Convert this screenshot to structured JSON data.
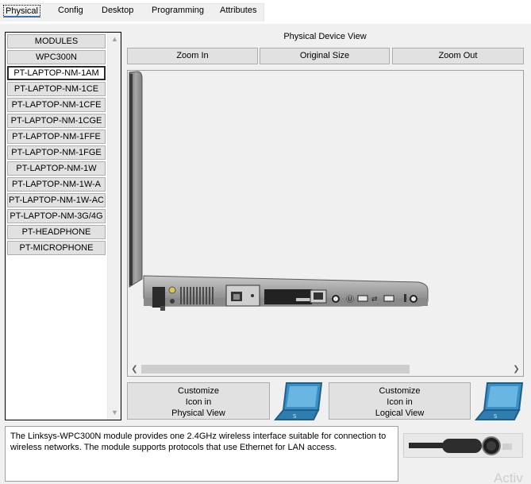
{
  "tabs": [
    {
      "label": "Physical",
      "active": true
    },
    {
      "label": "Config",
      "active": false
    },
    {
      "label": "Desktop",
      "active": false
    },
    {
      "label": "Programming",
      "active": false
    },
    {
      "label": "Attributes",
      "active": false
    }
  ],
  "modules": {
    "items": [
      {
        "label": "MODULES"
      },
      {
        "label": "WPC300N"
      },
      {
        "label": "PT-LAPTOP-NM-1AM",
        "selected": true
      },
      {
        "label": "PT-LAPTOP-NM-1CE"
      },
      {
        "label": "PT-LAPTOP-NM-1CFE"
      },
      {
        "label": "PT-LAPTOP-NM-1CGE"
      },
      {
        "label": "PT-LAPTOP-NM-1FFE"
      },
      {
        "label": "PT-LAPTOP-NM-1FGE"
      },
      {
        "label": "PT-LAPTOP-NM-1W"
      },
      {
        "label": "PT-LAPTOP-NM-1W-A"
      },
      {
        "label": "PT-LAPTOP-NM-1W-AC"
      },
      {
        "label": "PT-LAPTOP-NM-3G/4G"
      },
      {
        "label": "PT-HEADPHONE"
      },
      {
        "label": "PT-MICROPHONE"
      }
    ]
  },
  "view": {
    "title": "Physical Device View",
    "zoom_in": "Zoom In",
    "original_size": "Original Size",
    "zoom_out": "Zoom Out"
  },
  "customize": {
    "physical_l1": "Customize",
    "physical_l2": "Icon in",
    "physical_l3": "Physical View",
    "logical_l1": "Customize",
    "logical_l2": "Icon in",
    "logical_l3": "Logical View"
  },
  "description": "The Linksys-WPC300N module provides one 2.4GHz wireless interface suitable for connection to wireless networks. The module supports protocols that use Ethernet for LAN access.",
  "watermark": "Activ",
  "colors": {
    "window_bg": "#f0f0f0",
    "button_bg": "#e1e1e1",
    "laptop_icon": "#3a8fc4",
    "laptop_body": "#a9a9a9"
  }
}
